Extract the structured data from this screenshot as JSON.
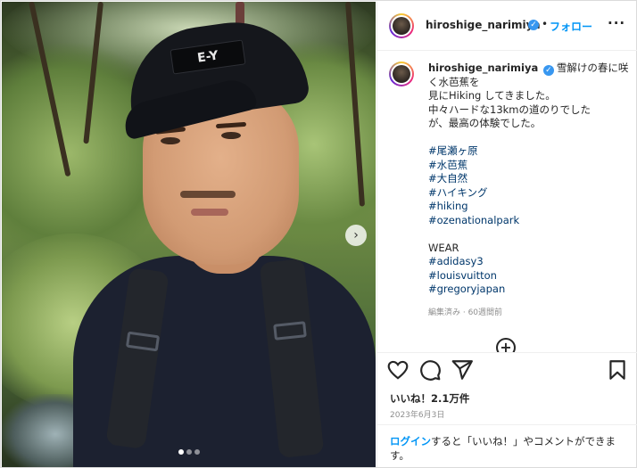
{
  "post": {
    "username": "hiroshige_narimiya",
    "follow_label": "フォロー",
    "separator": "•",
    "more_label": "···",
    "verified_mark": "✓"
  },
  "photo": {
    "cap_logo": "E-Y",
    "carousel_count": 3,
    "carousel_active": 1
  },
  "caption": {
    "username": "hiroshige_narimiya",
    "line1": "雪解けの春に咲",
    "line2": "く水芭蕉を",
    "line3": "見にHiking してきました。",
    "line4": "中々ハードな13kmの道のりでした",
    "line5": "が、最高の体験でした。",
    "hashtags": [
      "#尾瀬ヶ原",
      "#水芭蕉",
      "#大自然",
      "#ハイキング",
      "#hiking",
      "#ozenationalpark"
    ],
    "wear_label": "WEAR",
    "wear_tags": [
      "#adidasy3",
      "#louisvuitton",
      "#gregoryjapan"
    ],
    "meta": "編集済み · 60週間前"
  },
  "actions": {
    "load_more": "+"
  },
  "stats": {
    "likes": "いいね！2.1万件",
    "date": "2023年6月3日"
  },
  "login": {
    "link": "ログイン",
    "text": "すると「いいね！」やコメントができます。"
  },
  "colors": {
    "accent": "#0095f6",
    "hashtag": "#00376b",
    "muted": "#8e8e8e"
  }
}
